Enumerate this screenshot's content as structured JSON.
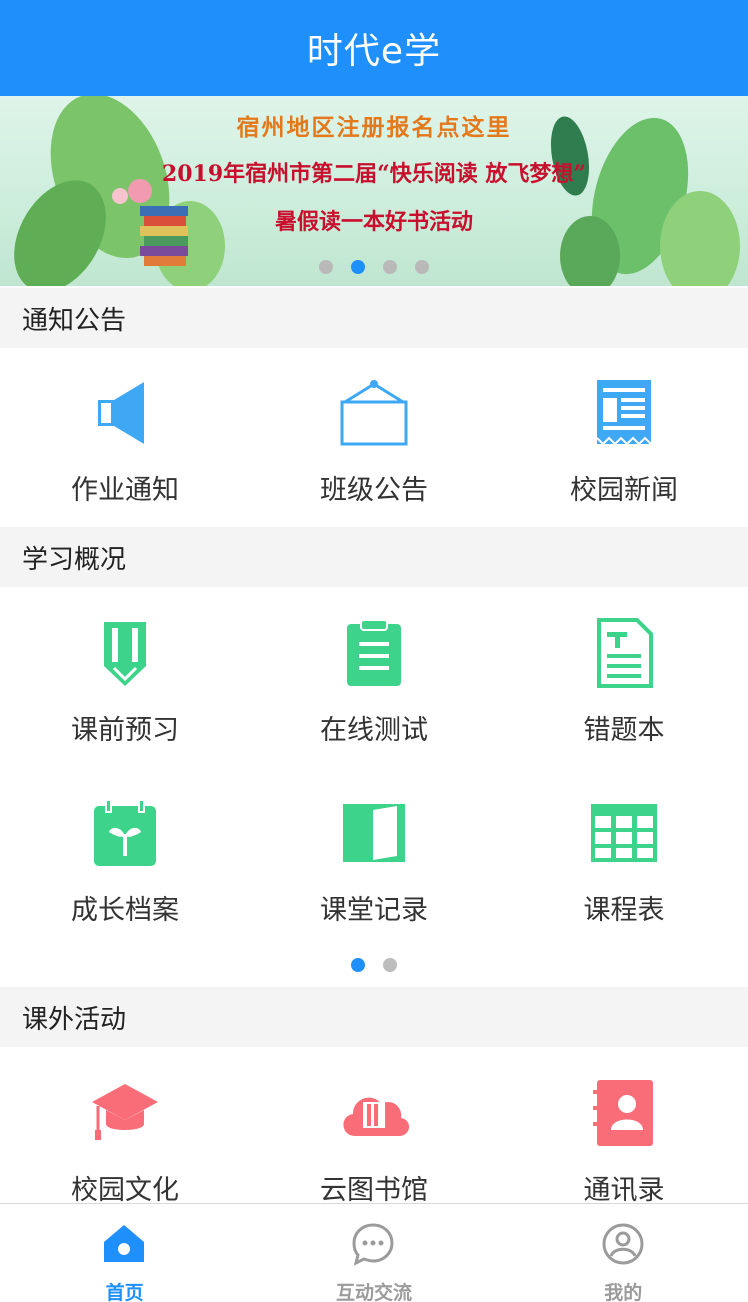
{
  "header": {
    "title": "时代e学"
  },
  "banner": {
    "line1": "宿州地区注册报名点这里",
    "line2": "2019年宿州市第二届“快乐阅读 放飞梦想”",
    "line3": "暑假读一本好书活动",
    "slide_count": 4,
    "active_slide": 2
  },
  "notice": {
    "title": "通知公告",
    "items": [
      {
        "label": "作业通知",
        "icon": "speaker-icon"
      },
      {
        "label": "班级公告",
        "icon": "notice-board-icon"
      },
      {
        "label": "校园新闻",
        "icon": "newspaper-icon"
      }
    ]
  },
  "study": {
    "title": "学习概况",
    "items": [
      {
        "label": "课前预习",
        "icon": "pencil-icon"
      },
      {
        "label": "在线测试",
        "icon": "clipboard-icon"
      },
      {
        "label": "错题本",
        "icon": "document-icon"
      },
      {
        "label": "成长档案",
        "icon": "sprout-calendar-icon"
      },
      {
        "label": "课堂记录",
        "icon": "open-book-icon"
      },
      {
        "label": "课程表",
        "icon": "timetable-grid-icon"
      }
    ],
    "page_count": 2,
    "active_page": 1
  },
  "activity": {
    "title": "课外活动",
    "items": [
      {
        "label": "校园文化",
        "icon": "graduation-cap-icon"
      },
      {
        "label": "云图书馆",
        "icon": "cloud-book-icon"
      },
      {
        "label": "通讯录",
        "icon": "contacts-book-icon"
      }
    ]
  },
  "tabbar": {
    "tabs": [
      {
        "label": "首页",
        "icon": "home-icon",
        "active": true
      },
      {
        "label": "互动交流",
        "icon": "chat-bubble-icon",
        "active": false
      },
      {
        "label": "我的",
        "icon": "user-icon",
        "active": false
      }
    ]
  },
  "colors": {
    "primary": "#1e8ffb",
    "notice_icon": "#3fa8f5",
    "study_icon": "#3ed38b",
    "activity_icon": "#f96d78",
    "section_bg": "#f4f4f4"
  }
}
